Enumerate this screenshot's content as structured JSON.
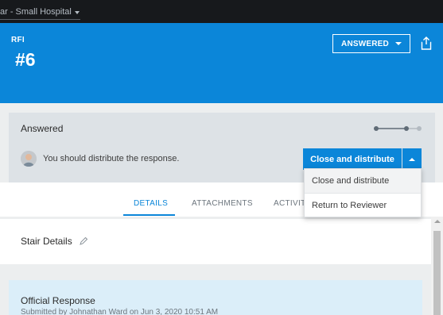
{
  "topbar": {
    "project_name": "ar - Small Hospital"
  },
  "header": {
    "type_label": "RFI",
    "number": "#6",
    "status_button": "ANSWERED",
    "share_icon": "share-icon"
  },
  "status_card": {
    "title": "Answered",
    "message": "You should distribute the response.",
    "primary_action": "Close and distribute",
    "progress_steps": 3,
    "progress_current": 2
  },
  "menu": {
    "items": [
      "Close and distribute",
      "Return to Reviewer"
    ]
  },
  "tabs": [
    "DETAILS",
    "ATTACHMENTS",
    "ACTIVIT"
  ],
  "active_tab": "DETAILS",
  "section": {
    "title": "Stair Details"
  },
  "response": {
    "title": "Official Response",
    "meta": "Submitted by Johnathan Ward on Jun 3, 2020 10:51 AM"
  },
  "colors": {
    "brand_blue": "#0b86d9",
    "topbar": "#17191c",
    "card_gray": "#dde2e6",
    "response_bg": "#dbeef9"
  }
}
